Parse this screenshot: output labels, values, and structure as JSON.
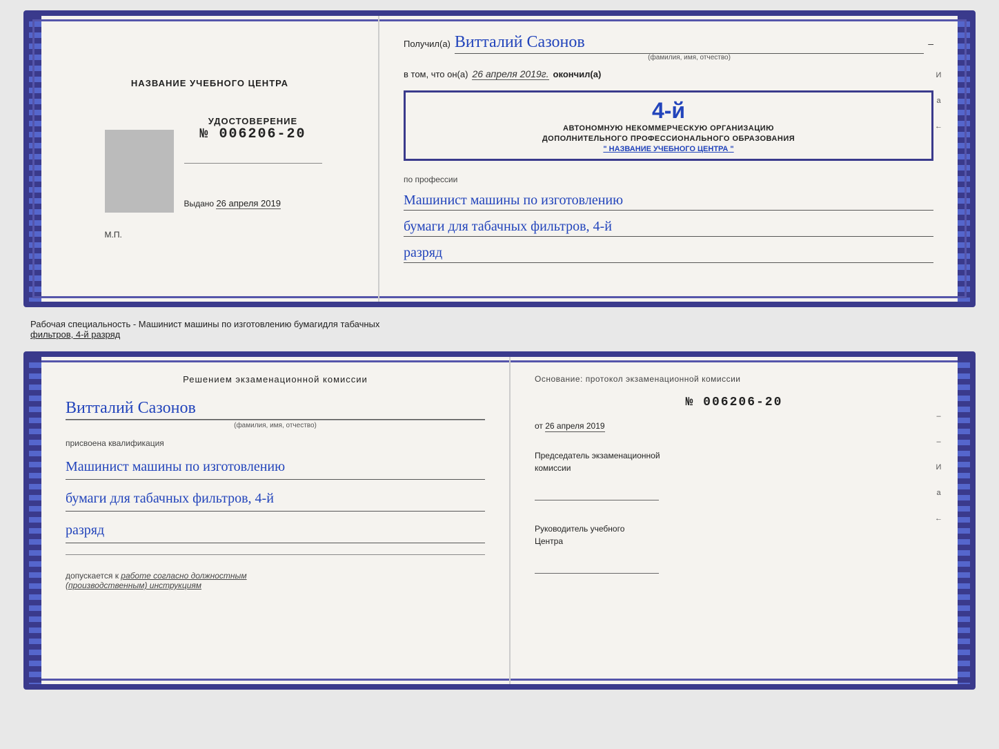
{
  "top_cert": {
    "left": {
      "title": "НАЗВАНИЕ УЧЕБНОГО ЦЕНТРА",
      "udost_label": "УДОСТОВЕРЕНИЕ",
      "udost_number": "№ 006206-20",
      "vydano_label": "Выдано",
      "vydano_date": "26 апреля 2019",
      "mp_label": "М.П."
    },
    "right": {
      "poluchil_label": "Получил(а)",
      "name": "Витталий Сазонов",
      "fio_hint": "(фамилия, имя, отчество)",
      "dash": "–",
      "vtom_label": "в том, что он(а)",
      "date_italic": "26 апреля 2019г.",
      "okoncil_label": "окончил(а)",
      "stamp_number": "4-й",
      "stamp_line1": "АВТОНОМНУЮ НЕКОММЕРЧЕСКУЮ ОРГАНИЗАЦИЮ",
      "stamp_line2": "ДОПОЛНИТЕЛЬНОГО ПРОФЕССИОНАЛЬНОГО ОБРАЗОВАНИЯ",
      "stamp_center_name": "\" НАЗВАНИЕ УЧЕБНОГО ЦЕНТРА \"",
      "i_label": "И",
      "a_label": "а",
      "arrow_label": "←",
      "po_professii": "по профессии",
      "prof_line1": "Машинист машины по изготовлению",
      "prof_line2": "бумаги для табачных фильтров, 4-й",
      "prof_line3": "разряд"
    }
  },
  "middle": {
    "text": "Рабочая специальность - Машинист машины по изготовлению бумагидля табачных",
    "text2": "фильтров, 4-й разряд"
  },
  "bottom_cert": {
    "left": {
      "resheniye": "Решением  экзаменационной  комиссии",
      "name": "Витталий Сазонов",
      "fio_hint": "(фамилия, имя, отчество)",
      "prisvoena": "присвоена квалификация",
      "qual_line1": "Машинист машины по изготовлению",
      "qual_line2": "бумаги для табачных фильтров, 4-й",
      "qual_line3": "разряд",
      "dopuskaetsya_label": "допускается к",
      "dopuskaetsya_val": "работе согласно должностным",
      "dopuskaetsya_val2": "(производственным) инструкциям"
    },
    "right": {
      "osnovanie": "Основание: протокол экзаменационной  комиссии",
      "number": "№  006206-20",
      "ot_label": "от",
      "ot_date": "26 апреля 2019",
      "dash1": "–",
      "dash2": "–",
      "predsedatel": "Председатель экзаменационной\nкомиссии",
      "i_label": "И",
      "a_label": "а",
      "arrow_label": "←",
      "rukovoditel": "Руководитель учебного\nЦентра"
    }
  }
}
